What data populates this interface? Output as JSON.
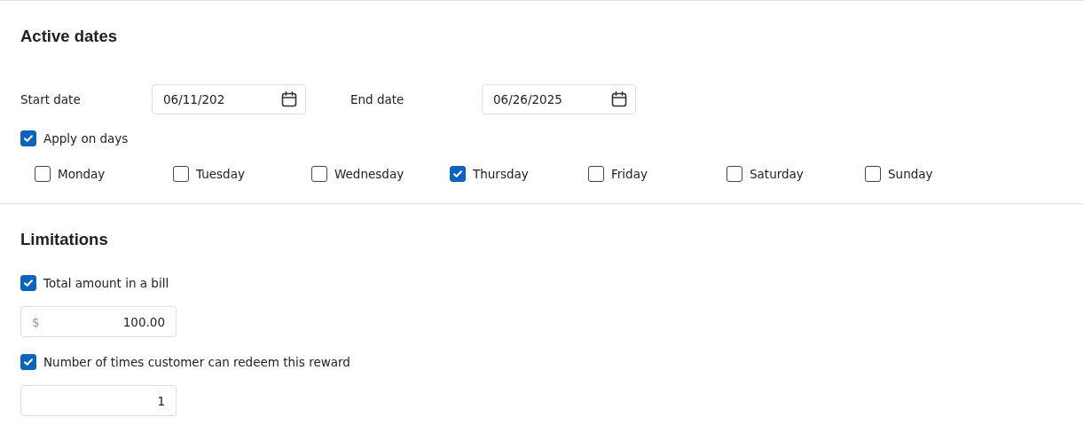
{
  "active_dates": {
    "title": "Active dates",
    "start_date": {
      "label": "Start date",
      "value": "06/11/202"
    },
    "end_date": {
      "label": "End date",
      "value": "06/26/2025"
    },
    "apply_on_days": {
      "label": "Apply on days",
      "checked": true
    },
    "days": [
      {
        "label": "Monday",
        "checked": false
      },
      {
        "label": "Tuesday",
        "checked": false
      },
      {
        "label": "Wednesday",
        "checked": false
      },
      {
        "label": "Thursday",
        "checked": true
      },
      {
        "label": "Friday",
        "checked": false
      },
      {
        "label": "Saturday",
        "checked": false
      },
      {
        "label": "Sunday",
        "checked": false
      }
    ]
  },
  "limitations": {
    "title": "Limitations",
    "items": [
      {
        "label": "Total amount in a bill",
        "checked": true,
        "prefix": "$",
        "value": "100.00"
      },
      {
        "label": "Number of times customer can redeem this reward",
        "checked": true,
        "value": "1"
      }
    ]
  }
}
